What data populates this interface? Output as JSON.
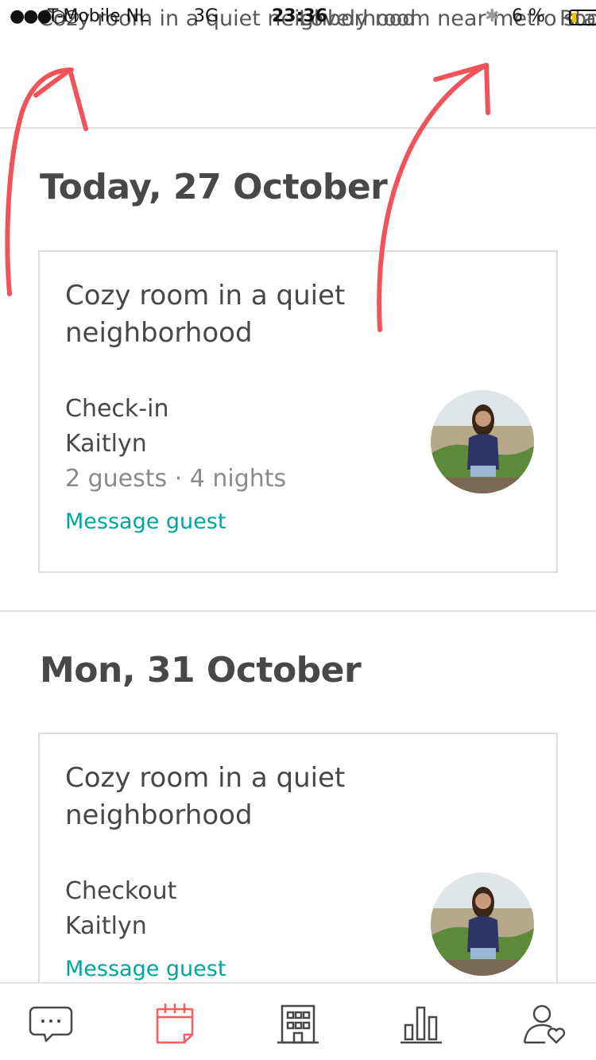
{
  "status_bar": {
    "signal": "●●●○○",
    "carrier": "T-Mobile NL",
    "network": "3G",
    "time": "23:36",
    "bluetooth_icon": "bluetooth-icon",
    "battery": "6 %"
  },
  "listing_tabs": [
    {
      "label": "Cozy room in a quiet neighborhood"
    },
    {
      "label": "Lovely room near metro station"
    },
    {
      "label": "Room in house"
    }
  ],
  "days": [
    {
      "heading": "Today, 27 October",
      "card": {
        "title": "Cozy room in a quiet neighborhood",
        "status": "Check-in",
        "guest": "Kaitlyn",
        "details": "2 guests · 4 nights",
        "action": "Message guest"
      }
    },
    {
      "heading": "Mon, 31 October",
      "card": {
        "title": "Cozy room in a quiet neighborhood",
        "status": "Checkout",
        "guest": "Kaitlyn",
        "action": "Message guest"
      }
    }
  ],
  "bottom_nav": [
    {
      "name": "Inbox",
      "icon": "chat-bubble-icon",
      "active": false
    },
    {
      "name": "Calendar",
      "icon": "calendar-icon",
      "active": true
    },
    {
      "name": "Listings",
      "icon": "building-icon",
      "active": false
    },
    {
      "name": "Stats",
      "icon": "bar-chart-icon",
      "active": false
    },
    {
      "name": "Profile",
      "icon": "profile-heart-icon",
      "active": false
    }
  ],
  "colors": {
    "accent": "#ff5a5f",
    "link": "#00a699",
    "annotation": "#f0545a",
    "text": "#484848",
    "muted": "#8a8a8a"
  }
}
